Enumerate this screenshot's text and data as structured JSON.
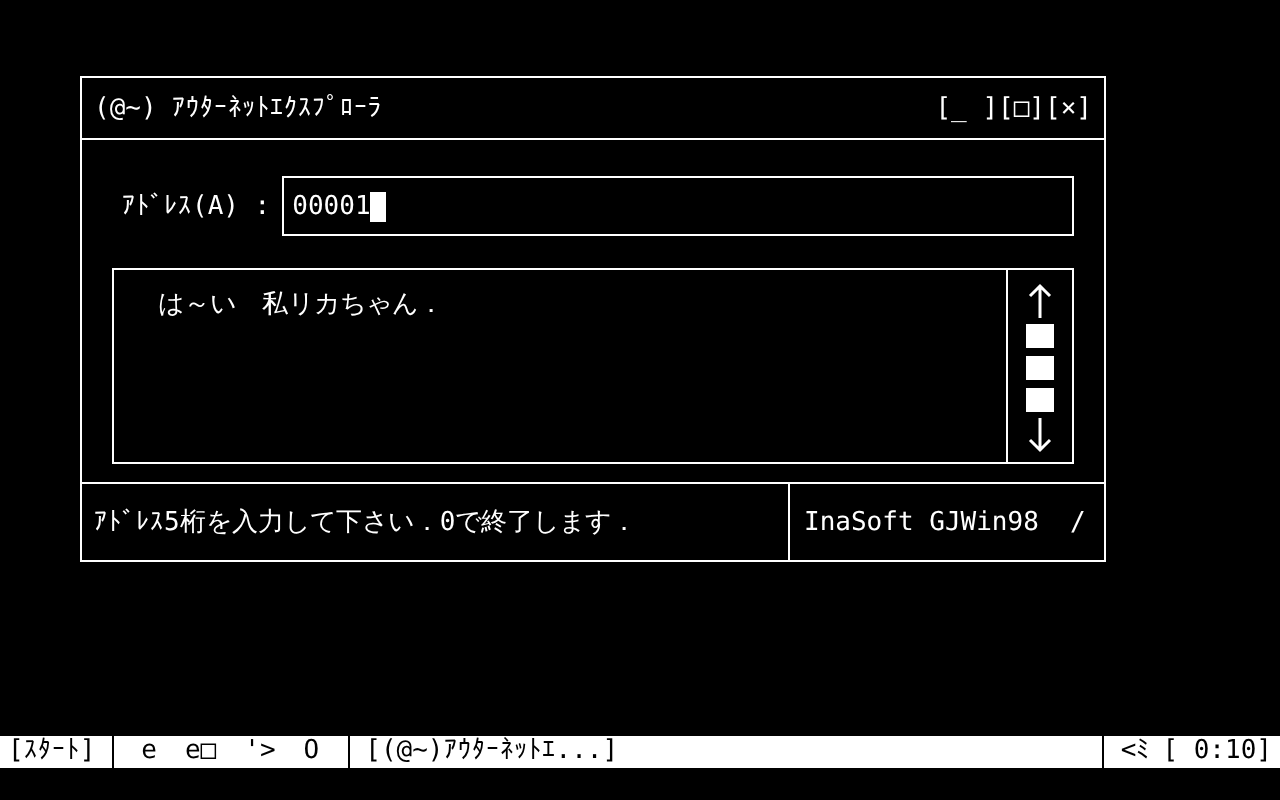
{
  "window": {
    "title": "(@~) ｱｳﾀｰﾈｯﾄｴｸｽﾌﾟﾛｰﾗ",
    "title_buttons": [
      "[_ ]",
      "[□]",
      "[×]"
    ],
    "address": {
      "label": "ｱﾄﾞﾚｽ(A) :",
      "value": "00001"
    },
    "content": "は～い　私リカちゃん．",
    "status": "ｱﾄﾞﾚｽ5桁を入力して下さい．0で終了します．",
    "status_right": "InaSoft GJWin98  /"
  },
  "taskbar": {
    "start": "[ｽﾀｰﾄ]",
    "quick_launch": [
      "e",
      "e□",
      "'>",
      "O"
    ],
    "task": "[(@~)ｱｳﾀｰﾈｯﾄｴ...]",
    "tray": "<ﾐ",
    "clock": "[ 0:10]"
  }
}
